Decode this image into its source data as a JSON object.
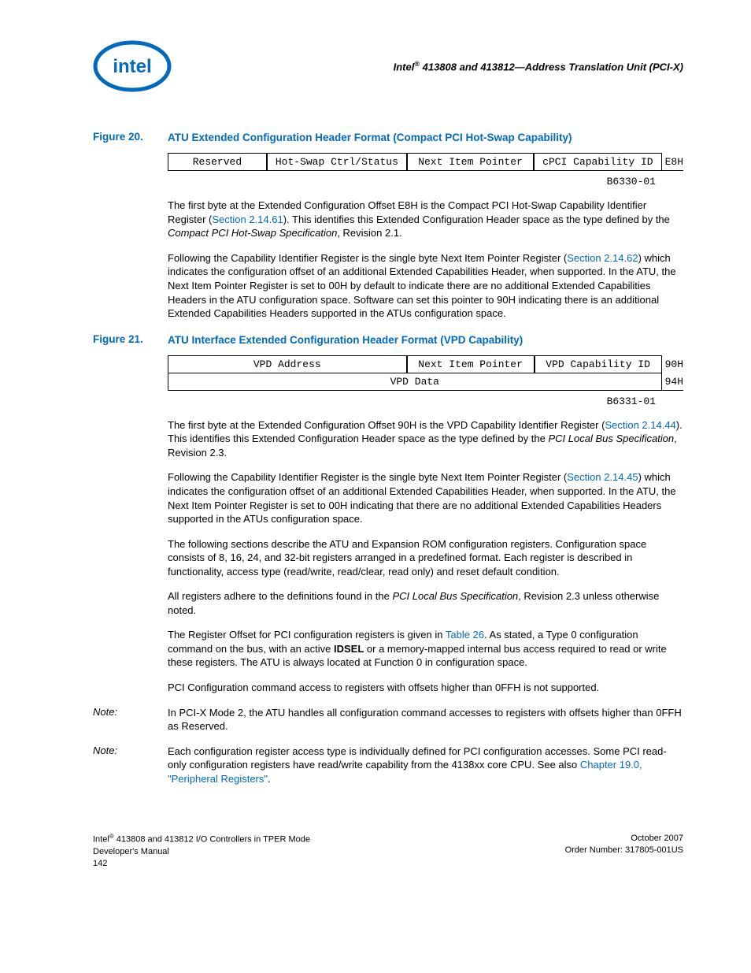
{
  "header": {
    "title_pre": "Intel",
    "title_reg": "®",
    "title_post": " 413808 and 413812—Address Translation Unit (PCI-X)"
  },
  "fig20": {
    "label": "Figure 20.",
    "title": "ATU Extended Configuration Header Format (Compact PCI Hot-Swap Capability)",
    "cells": {
      "c1": "Reserved",
      "c2": "Hot-Swap Ctrl/Status",
      "c3": "Next Item Pointer",
      "c4": "cPCI Capability ID",
      "off": "E8H"
    },
    "code": "B6330-01"
  },
  "para1": {
    "t1": "The first byte at the Extended Configuration Offset E8H is the Compact PCI Hot-Swap Capability Identifier Register (",
    "link1": "Section 2.14.61",
    "t2": "). This identifies this Extended Configuration Header space as the type defined by the ",
    "ital1": "Compact PCI Hot-Swap Specification",
    "t3": ", Revision 2.1."
  },
  "para2": {
    "t1": "Following the Capability Identifier Register is the single byte Next Item Pointer Register (",
    "link1": "Section 2.14.62",
    "t2": ") which indicates the configuration offset of an additional Extended Capabilities Header, when supported. In the ATU, the Next Item Pointer Register is set to 00H by default to indicate there are no additional Extended Capabilities Headers in the ATU configuration space. Software can set this pointer to 90H indicating there is an additional Extended Capabilities Headers supported in the ATUs configuration space."
  },
  "fig21": {
    "label": "Figure 21.",
    "title": "ATU Interface Extended Configuration Header Format (VPD Capability)",
    "row1": {
      "c1": "VPD Address",
      "c2": "Next Item Pointer",
      "c3": "VPD Capability ID",
      "off": "90H"
    },
    "row2": {
      "c1": "VPD Data",
      "off": "94H"
    },
    "code": "B6331-01"
  },
  "para3": {
    "t1": "The first byte at the Extended Configuration Offset 90H is the VPD Capability Identifier Register (",
    "link1": "Section 2.14.44",
    "t2": "). This identifies this Extended Configuration Header space as the type defined by the ",
    "ital1": "PCI Local Bus Specification",
    "t3": ", Revision 2.3."
  },
  "para4": {
    "t1": "Following the Capability Identifier Register is the single byte Next Item Pointer Register (",
    "link1": "Section 2.14.45",
    "t2": ") which indicates the configuration offset of an additional Extended Capabilities Header, when supported. In the ATU, the Next Item Pointer Register is set to 00H indicating that there are no additional Extended Capabilities Headers supported in the ATUs configuration space."
  },
  "para5": "The following sections describe the ATU and Expansion ROM configuration registers. Configuration space consists of 8, 16, 24, and 32-bit registers arranged in a predefined format. Each register is described in functionality, access type (read/write, read/clear, read only) and reset default condition.",
  "para6": {
    "t1": "All registers adhere to the definitions found in the ",
    "ital1": "PCI Local Bus Specification",
    "t2": ", Revision 2.3 unless otherwise noted."
  },
  "para7": {
    "t1": "The Register Offset for PCI configuration registers is given in ",
    "link1": "Table 26",
    "t2": ". As stated, a Type 0 configuration command on the bus, with an active ",
    "bold1": "IDSEL",
    "t3": " or a memory-mapped internal bus access required to read or write these registers. The ATU is always located at Function 0 in configuration space."
  },
  "para8": "PCI Configuration command access to registers with offsets higher than 0FFH is not supported.",
  "note1": {
    "label": "Note:",
    "text": "In PCI-X Mode 2, the ATU handles all configuration command accesses to registers with offsets higher than 0FFH as Reserved."
  },
  "note2": {
    "label": "Note:",
    "t1": "Each configuration register access type is individually defined for PCI configuration accesses. Some PCI read-only configuration registers have read/write capability from the 4138xx core CPU. See also ",
    "link1": "Chapter 19.0, \"Peripheral Registers\"",
    "t2": "."
  },
  "footer": {
    "left_l1_pre": "Intel",
    "left_l1_reg": "®",
    "left_l1_post": " 413808 and 413812 I/O Controllers in TPER Mode",
    "left_l2": "Developer's Manual",
    "left_l3": "142",
    "right_l1": "October 2007",
    "right_l2": "Order Number: 317805-001US"
  }
}
